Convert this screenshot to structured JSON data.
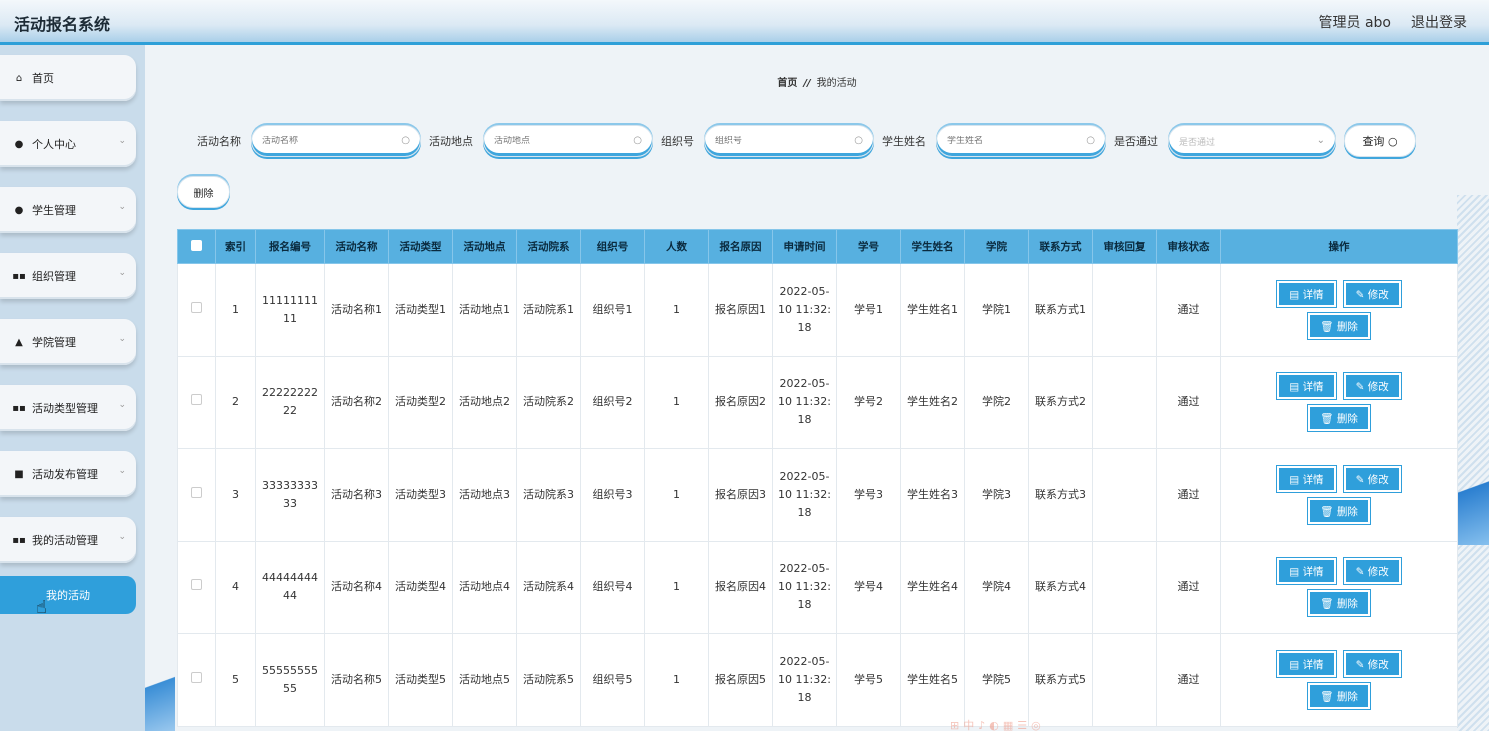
{
  "app": {
    "title": "活动报名系统",
    "admin_label": "管理员 abo",
    "logout_label": "退出登录"
  },
  "sidebar": {
    "items": [
      {
        "label": "首页",
        "icon": "home-icon"
      },
      {
        "label": "个人中心",
        "icon": "user-icon"
      },
      {
        "label": "学生管理",
        "icon": "user-icon"
      },
      {
        "label": "组织管理",
        "icon": "grid-icon"
      },
      {
        "label": "学院管理",
        "icon": "thumb-icon"
      },
      {
        "label": "活动类型管理",
        "icon": "grid-icon"
      },
      {
        "label": "活动发布管理",
        "icon": "briefcase-icon"
      },
      {
        "label": "我的活动管理",
        "icon": "grid-icon"
      }
    ],
    "active_sub": "我的活动"
  },
  "breadcrumb": {
    "home": "首页",
    "separator": "//",
    "current": "我的活动"
  },
  "search": {
    "fields": [
      {
        "label": "活动名称",
        "placeholder": "活动名称"
      },
      {
        "label": "活动地点",
        "placeholder": "活动地点"
      },
      {
        "label": "组织号",
        "placeholder": "组织号"
      },
      {
        "label": "学生姓名",
        "placeholder": "学生姓名"
      }
    ],
    "select": {
      "label": "是否通过",
      "placeholder": "是否通过"
    },
    "query_label": "查询"
  },
  "toolbar": {
    "delete_label": "删除"
  },
  "table": {
    "headers": [
      "索引",
      "报名编号",
      "活动名称",
      "活动类型",
      "活动地点",
      "活动院系",
      "组织号",
      "人数",
      "报名原因",
      "申请时间",
      "学号",
      "学生姓名",
      "学院",
      "联系方式",
      "审核回复",
      "审核状态",
      "操作"
    ],
    "rows": [
      {
        "index": "1",
        "reg_no": "1111111111",
        "activity_name": "活动名称1",
        "activity_type": "活动类型1",
        "location": "活动地点1",
        "department": "活动院系1",
        "org_no": "组织号1",
        "people": "1",
        "reason": "报名原因1",
        "apply_time": "2022-05-10 11:32:18",
        "student_no": "学号1",
        "student_name": "学生姓名1",
        "college": "学院1",
        "contact": "联系方式1",
        "reply": "",
        "status": "通过"
      },
      {
        "index": "2",
        "reg_no": "2222222222",
        "activity_name": "活动名称2",
        "activity_type": "活动类型2",
        "location": "活动地点2",
        "department": "活动院系2",
        "org_no": "组织号2",
        "people": "1",
        "reason": "报名原因2",
        "apply_time": "2022-05-10 11:32:18",
        "student_no": "学号2",
        "student_name": "学生姓名2",
        "college": "学院2",
        "contact": "联系方式2",
        "reply": "",
        "status": "通过"
      },
      {
        "index": "3",
        "reg_no": "3333333333",
        "activity_name": "活动名称3",
        "activity_type": "活动类型3",
        "location": "活动地点3",
        "department": "活动院系3",
        "org_no": "组织号3",
        "people": "1",
        "reason": "报名原因3",
        "apply_time": "2022-05-10 11:32:18",
        "student_no": "学号3",
        "student_name": "学生姓名3",
        "college": "学院3",
        "contact": "联系方式3",
        "reply": "",
        "status": "通过"
      },
      {
        "index": "4",
        "reg_no": "4444444444",
        "activity_name": "活动名称4",
        "activity_type": "活动类型4",
        "location": "活动地点4",
        "department": "活动院系4",
        "org_no": "组织号4",
        "people": "1",
        "reason": "报名原因4",
        "apply_time": "2022-05-10 11:32:18",
        "student_no": "学号4",
        "student_name": "学生姓名4",
        "college": "学院4",
        "contact": "联系方式4",
        "reply": "",
        "status": "通过"
      },
      {
        "index": "5",
        "reg_no": "5555555555",
        "activity_name": "活动名称5",
        "activity_type": "活动类型5",
        "location": "活动地点5",
        "department": "活动院系5",
        "org_no": "组织号5",
        "people": "1",
        "reason": "报名原因5",
        "apply_time": "2022-05-10 11:32:18",
        "student_no": "学号5",
        "student_name": "学生姓名5",
        "college": "学院5",
        "contact": "联系方式5",
        "reply": "",
        "status": "通过"
      }
    ],
    "actions": {
      "detail": "详情",
      "edit": "修改",
      "delete": "删除"
    }
  },
  "colors": {
    "accent": "#2f9fdb",
    "header": "#57b0e0"
  }
}
